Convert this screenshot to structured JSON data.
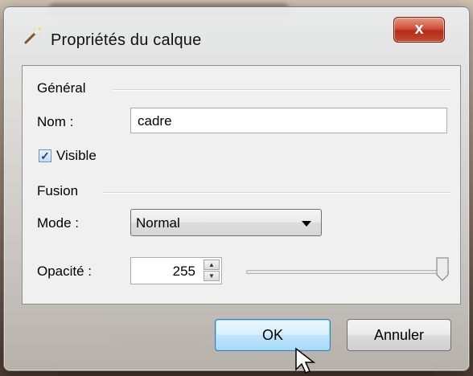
{
  "window": {
    "title": "Propriétés du calque",
    "close_glyph": "x",
    "icon": "wand-icon"
  },
  "general": {
    "section_label": "Général",
    "name_label": "Nom :",
    "name_value": "cadre",
    "visible_label": "Visible",
    "visible_checked": true
  },
  "fusion": {
    "section_label": "Fusion",
    "mode_label": "Mode :",
    "mode_value": "Normal",
    "opacity_label": "Opacité :",
    "opacity_value": "255",
    "opacity_level": 1.0
  },
  "buttons": {
    "ok_label": "OK",
    "cancel_label": "Annuler"
  },
  "colors": {
    "close_button": "#c64a2f",
    "ok_highlight": "#3c7fb1"
  }
}
